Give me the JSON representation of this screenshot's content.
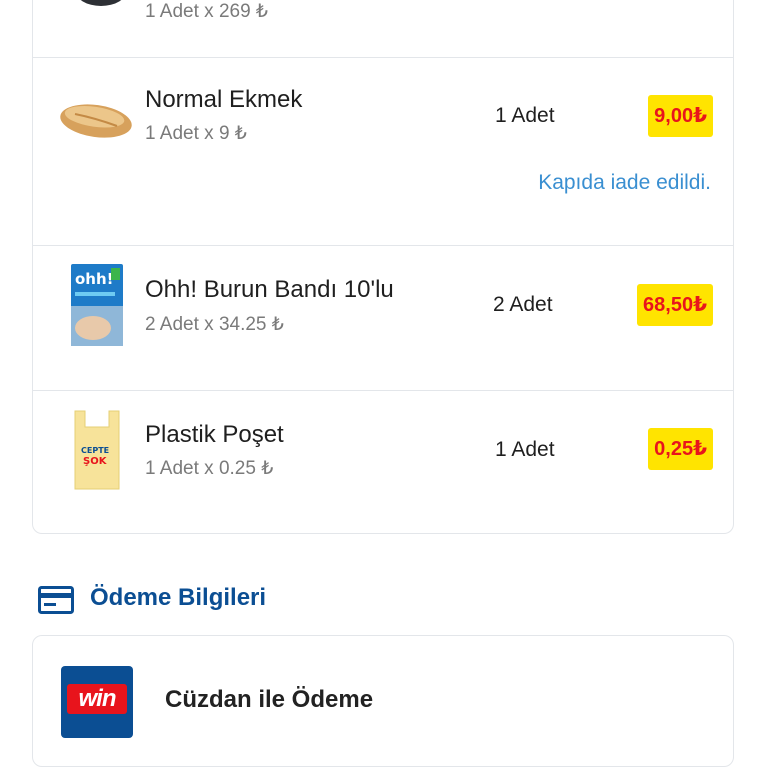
{
  "items": [
    {
      "sub": "1 Adet x 269 ₺",
      "icon": "product-thumbnail"
    },
    {
      "name": "Normal Ekmek",
      "sub": "1 Adet x 9 ₺",
      "qty": "1 Adet",
      "price": "9,00₺",
      "note": "Kapıda iade edildi.",
      "icon": "bread-image"
    },
    {
      "name": "Ohh! Burun Bandı 10'lu",
      "sub": "2 Adet x 34.25 ₺",
      "qty": "2 Adet",
      "price": "68,50₺",
      "icon": "nasal-strip-box-image",
      "brand": "ohh!"
    },
    {
      "name": "Plastik Poşet",
      "sub": "1 Adet x 0.25 ₺",
      "qty": "1 Adet",
      "price": "0,25₺",
      "icon": "plastic-bag-image",
      "brand": "CEPTE ŞOK"
    }
  ],
  "payment_section": {
    "title": "Ödeme Bilgileri",
    "icon": "credit-card-icon",
    "method": {
      "label": "Cüzdan ile Ödeme",
      "logo_text": "win"
    }
  },
  "colors": {
    "price_bg": "#ffe400",
    "price_text": "#e8141c",
    "link": "#3a8fd1",
    "section_title": "#0b4e93"
  }
}
